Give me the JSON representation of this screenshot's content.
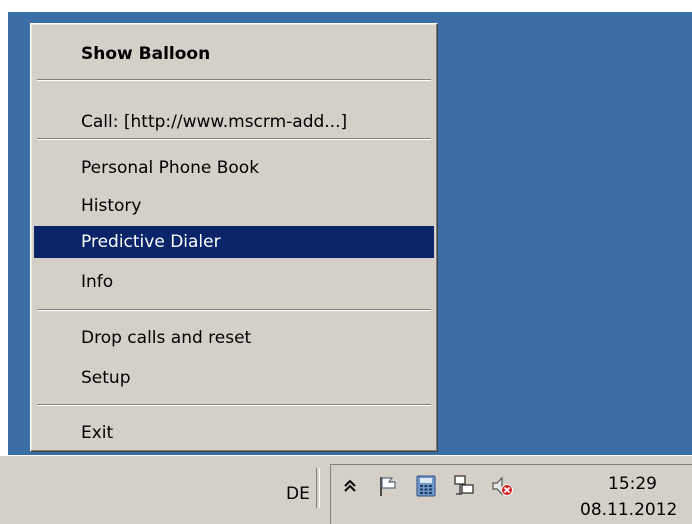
{
  "menu": {
    "items": [
      {
        "label": "Show Balloon"
      },
      {
        "label": "Call: [http://www.mscrm-add...]"
      },
      {
        "label": "Personal Phone Book"
      },
      {
        "label": "History"
      },
      {
        "label": "Predictive Dialer"
      },
      {
        "label": "Info"
      },
      {
        "label": "Drop calls and reset"
      },
      {
        "label": "Setup"
      },
      {
        "label": "Exit"
      }
    ],
    "selected": "Predictive Dialer"
  },
  "taskbar": {
    "language": "DE",
    "tray_icons": [
      "chevron-up-icon",
      "action-center-flag-icon",
      "phone-app-icon",
      "network-icon",
      "volume-muted-icon"
    ],
    "clock": {
      "time": "15:29",
      "date": "08.11.2012"
    }
  },
  "colors": {
    "desktop": "#3a6ea5",
    "menu_bg": "#d4d0c8",
    "selection": "#0a246a"
  }
}
